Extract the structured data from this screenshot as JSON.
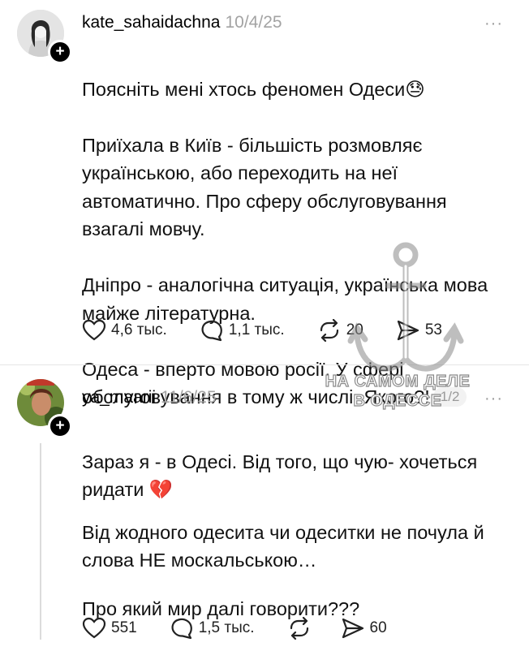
{
  "post1": {
    "username": "kate_sahaidachna",
    "date": "10/4/25",
    "more": "···",
    "lines": [
      "Поясніть мені хтось феномен Одеси😓",
      "Приїхала в Київ -  більшість розмовляє українською, або переходить на неї автоматично. Про сферу обслуговування взагалі мовчу.",
      "Дніпро - аналогічна ситуація, українська мова майже літературна.",
      "Одеса - вперто мовою росії. У сфері обслуговування в тому ж числі. Якого?!"
    ],
    "page_indicator": "1/2",
    "likes": "4,6 тыс.",
    "comments": "1,1 тыс.",
    "reposts": "20",
    "shares": "53"
  },
  "post2": {
    "username": "ya_maarii",
    "date": "11/6/25",
    "more": "···",
    "para1": "Зараз я - в Одесі. Від того, що чую- хочеться ридати 💔",
    "para2": "Від жодного одесита чи одеситки не почула й слова НЕ москальською…",
    "para3": "Про який мир далі говорити???",
    "likes": "551",
    "comments": "1,5 тыс.",
    "reposts": "",
    "shares": "60"
  },
  "watermark": {
    "line1": "НА САМОМ ДЕЛЕ",
    "line2": "В ОДЕССЕ"
  }
}
